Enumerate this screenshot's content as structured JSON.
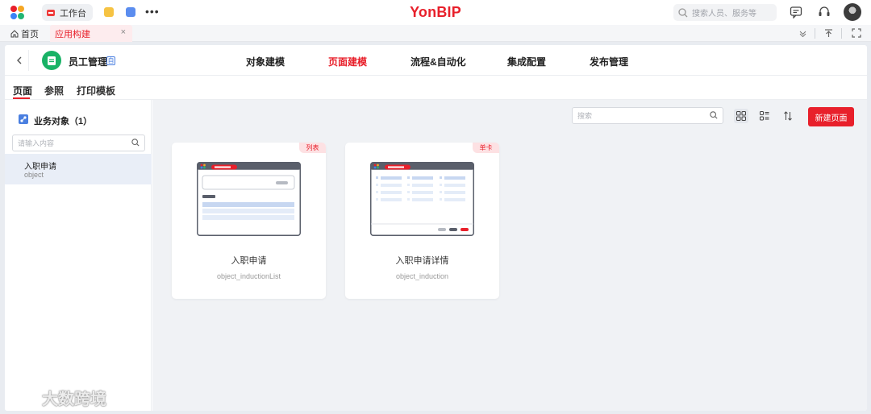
{
  "topbar": {
    "workspace_tab": "工作台",
    "brand": "YonBIP",
    "search_placeholder": "搜索人员、服务等"
  },
  "tabstrip": {
    "home_label": "首页",
    "active_tab_label": "应用构建",
    "close_glyph": "×"
  },
  "header": {
    "app_name": "员工管理",
    "app_badge": "自",
    "nav": [
      "对象建模",
      "页面建模",
      "流程&自动化",
      "集成配置",
      "发布管理"
    ],
    "active_nav": "页面建模"
  },
  "subtabs": [
    "页面",
    "参照",
    "打印模板"
  ],
  "sidebar": {
    "title": "业务对象（1）",
    "search_placeholder": "请输入内容",
    "items": [
      {
        "name": "入职申请",
        "code": "object"
      }
    ]
  },
  "content": {
    "search_placeholder": "搜索",
    "new_button": "新建页面",
    "cards": [
      {
        "tag": "列表",
        "title": "入职申请",
        "code": "object_inductionList"
      },
      {
        "tag": "单卡",
        "title": "入职申请详情",
        "code": "object_induction"
      }
    ]
  },
  "watermark": "大数跨境",
  "colors": {
    "accent": "#e8202b",
    "app_icon": "#19b266",
    "selected_row": "#e9eef7"
  }
}
